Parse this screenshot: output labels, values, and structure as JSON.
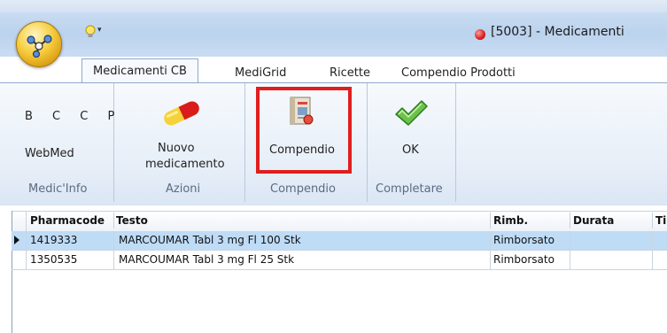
{
  "window": {
    "title": "[5003] - Medicamenti"
  },
  "ribbon_tabs": [
    {
      "label": "Medicamenti CB",
      "active": true
    },
    {
      "label": "MediGrid",
      "active": false
    },
    {
      "label": "Ricette",
      "active": false
    },
    {
      "label": "Compendio Prodotti",
      "active": false
    }
  ],
  "groups": {
    "medicinfo": {
      "letters": "B C C P",
      "webmed": "WebMed",
      "label": "Medic'Info"
    },
    "azioni": {
      "button_label_1": "Nuovo",
      "button_label_2": "medicamento",
      "label": "Azioni",
      "icon": "pill-icon"
    },
    "compendio": {
      "button_label": "Compendio",
      "label": "Compendio",
      "icon": "compendium-book-icon",
      "highlight_color": "#e01e1e"
    },
    "completare": {
      "button_label": "OK",
      "label": "Completare",
      "icon": "checkmark-icon"
    }
  },
  "grid": {
    "columns": [
      "Pharmacode",
      "Testo",
      "Rimb.",
      "Durata",
      "Ti"
    ],
    "rows": [
      {
        "pharmacode": "1419333",
        "testo": "MARCOUMAR Tabl 3 mg Fl 100 Stk",
        "rimb": "Rimborsato",
        "selected": true
      },
      {
        "pharmacode": "1350535",
        "testo": "MARCOUMAR Tabl 3 mg Fl 25 Stk",
        "rimb": "Rimborsato",
        "selected": false
      }
    ]
  },
  "colors": {
    "selection": "#bfdcf7",
    "ribbon_bg": "#e6eef8"
  }
}
